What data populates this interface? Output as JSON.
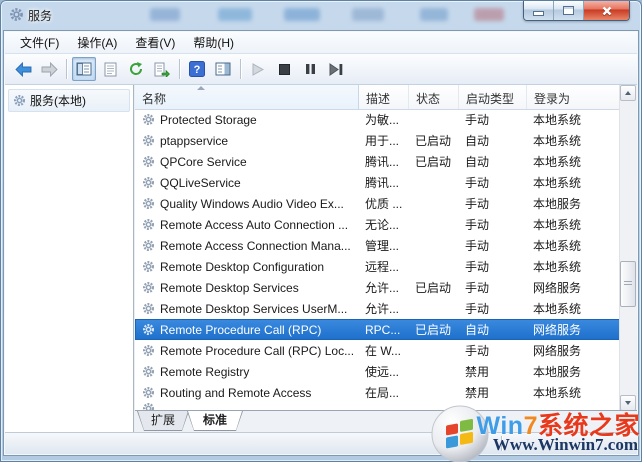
{
  "window": {
    "title": "服务",
    "controls": [
      "minimize",
      "maximize",
      "close"
    ]
  },
  "menu": {
    "items": [
      "文件(F)",
      "操作(A)",
      "查看(V)",
      "帮助(H)"
    ]
  },
  "toolbar": {
    "icons": [
      "back",
      "forward",
      "show-console-tree",
      "properties",
      "refresh",
      "export-list",
      "help",
      "show-action-pane",
      "start-service",
      "stop-service",
      "pause-service",
      "restart-service"
    ]
  },
  "sidebar": {
    "root_label": "服务(本地)"
  },
  "table": {
    "columns": [
      "名称",
      "描述",
      "状态",
      "启动类型",
      "登录为"
    ],
    "rows": [
      {
        "name": "Protected Storage",
        "desc": "为敏...",
        "status": "",
        "startup": "手动",
        "logon": "本地系统"
      },
      {
        "name": "ptappservice",
        "desc": "用于...",
        "status": "已启动",
        "startup": "自动",
        "logon": "本地系统"
      },
      {
        "name": "QPCore Service",
        "desc": "腾讯...",
        "status": "已启动",
        "startup": "自动",
        "logon": "本地系统"
      },
      {
        "name": "QQLiveService",
        "desc": "腾讯...",
        "status": "",
        "startup": "手动",
        "logon": "本地系统"
      },
      {
        "name": "Quality Windows Audio Video Ex...",
        "desc": "优质 ...",
        "status": "",
        "startup": "手动",
        "logon": "本地服务"
      },
      {
        "name": "Remote Access Auto Connection ...",
        "desc": "无论...",
        "status": "",
        "startup": "手动",
        "logon": "本地系统"
      },
      {
        "name": "Remote Access Connection Mana...",
        "desc": "管理...",
        "status": "",
        "startup": "手动",
        "logon": "本地系统"
      },
      {
        "name": "Remote Desktop Configuration",
        "desc": "远程...",
        "status": "",
        "startup": "手动",
        "logon": "本地系统"
      },
      {
        "name": "Remote Desktop Services",
        "desc": "允许...",
        "status": "已启动",
        "startup": "手动",
        "logon": "网络服务"
      },
      {
        "name": "Remote Desktop Services UserM...",
        "desc": "允许...",
        "status": "",
        "startup": "手动",
        "logon": "本地系统"
      },
      {
        "name": "Remote Procedure Call (RPC)",
        "desc": "RPC...",
        "status": "已启动",
        "startup": "自动",
        "logon": "网络服务",
        "selected": true
      },
      {
        "name": "Remote Procedure Call (RPC) Loc...",
        "desc": "在 W...",
        "status": "",
        "startup": "手动",
        "logon": "网络服务"
      },
      {
        "name": "Remote Registry",
        "desc": "使远...",
        "status": "",
        "startup": "禁用",
        "logon": "本地服务"
      },
      {
        "name": "Routing and Remote Access",
        "desc": "在局...",
        "status": "",
        "startup": "禁用",
        "logon": "本地系统"
      }
    ]
  },
  "tabs": {
    "items": [
      "扩展",
      "标准"
    ],
    "active": "标准"
  },
  "watermark": {
    "win": "Win",
    "seven": "7",
    "site": "系统之家",
    "url": "Www.Winwin7.com"
  },
  "colors": {
    "selection": "#2a7cd4",
    "close_red": "#d9503f",
    "accent_blue": "#3f9de8",
    "wm_orange": "#f08921",
    "wm_red": "#e8391d"
  }
}
